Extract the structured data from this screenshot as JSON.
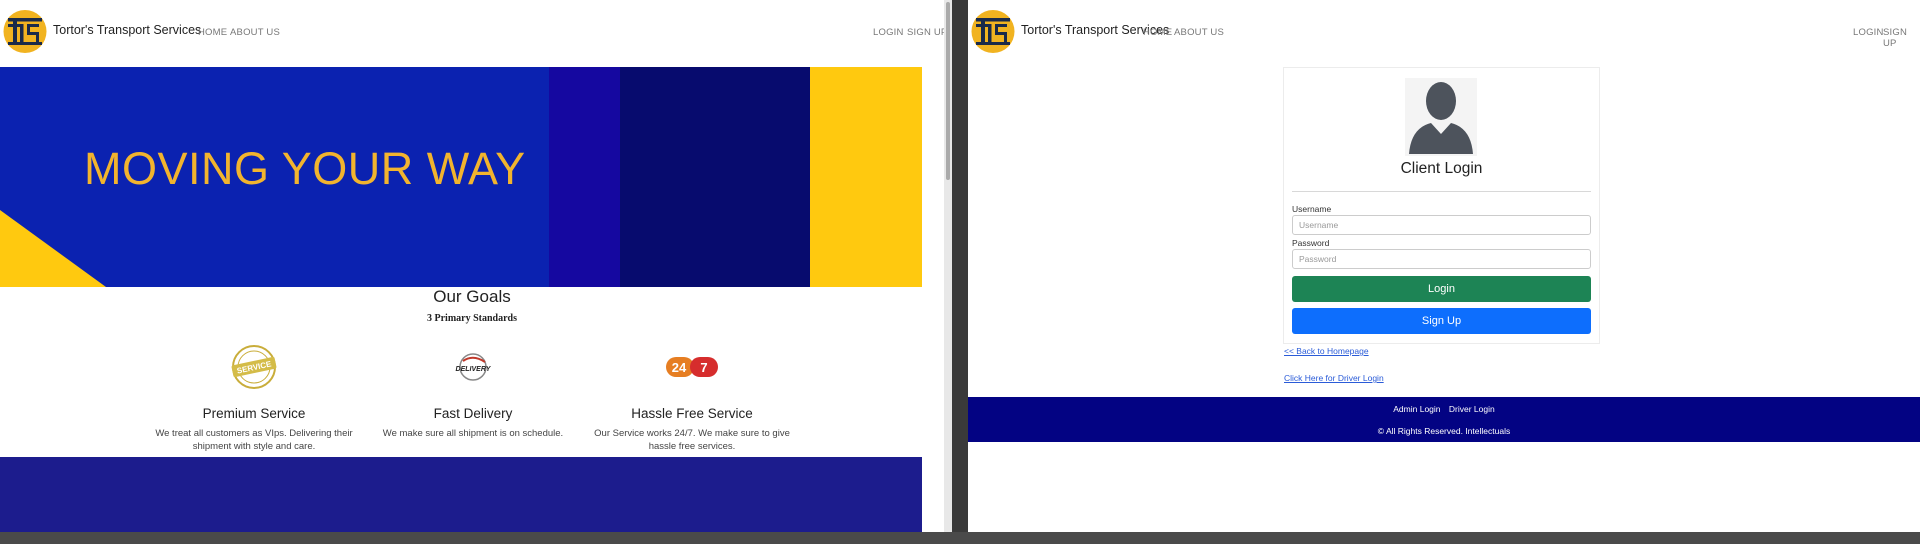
{
  "left": {
    "brand": "Tortor's Transport Services",
    "nav": {
      "home": "HOME",
      "about": "ABOUT US",
      "login": "LOGIN",
      "signup": "SIGN UP"
    },
    "hero_title": "MOVING YOUR WAY",
    "goals_title": "Our Goals",
    "goals_subtitle": "3 Primary Standards",
    "goals": [
      {
        "title": "Premium Service",
        "text": "We treat all customers as VIps. Delivering their shipment with style and care.",
        "icon": "premium-service-badge-icon"
      },
      {
        "title": "Fast Delivery",
        "text": "We make sure all shipment is on schedule.",
        "icon": "fast-delivery-icon"
      },
      {
        "title": "Hassle Free Service",
        "text": "Our Service works 24/7. We make sure to give hassle free services.",
        "icon": "24-7-icon"
      }
    ]
  },
  "right": {
    "brand": "Tortor's Transport Services",
    "nav": {
      "home": "HOME",
      "about": "ABOUT US",
      "login": "LOGIN",
      "signup": "SIGN UP"
    },
    "card_title": "Client Login",
    "username_label": "Username",
    "username_placeholder": "Username",
    "password_label": "Password",
    "password_placeholder": "Password",
    "login_button": "Login",
    "signup_button": "Sign Up",
    "back_link": "<< Back to Homepage",
    "driver_link": "Click Here for Driver Login",
    "footer": {
      "admin_login": "Admin Login",
      "driver_login": "Driver Login",
      "copyright": "© All Rights Reserved. Intellectuals"
    }
  },
  "colors": {
    "hero_blue": "#0b22b0",
    "accent_yellow": "#ffc90f",
    "login_green": "#1d8455",
    "signup_blue": "#0d6efd",
    "footer_navy": "#030383"
  }
}
